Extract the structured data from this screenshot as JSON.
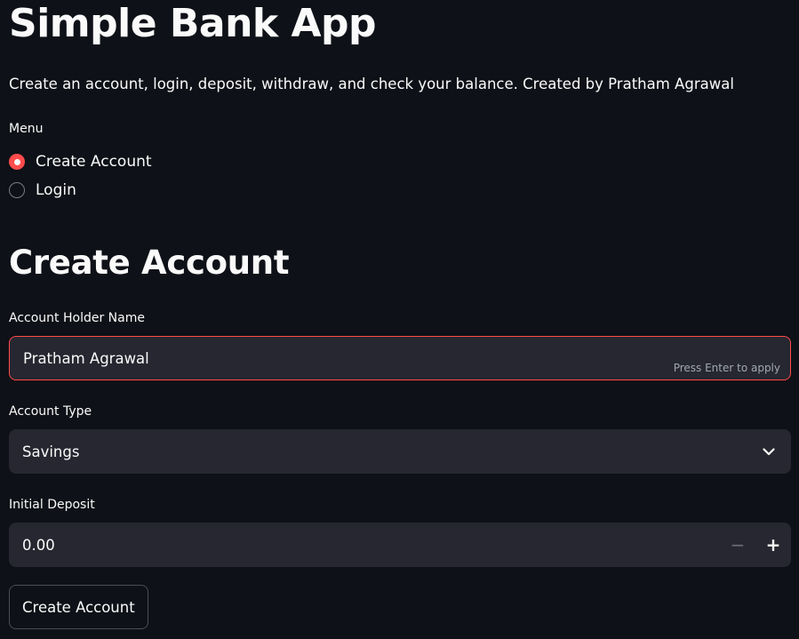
{
  "app": {
    "title": "Simple Bank App",
    "subtitle": "Create an account, login, deposit, withdraw, and check your balance. Created by Pratham Agrawal"
  },
  "menu": {
    "label": "Menu",
    "options": [
      {
        "label": "Create Account",
        "selected": true
      },
      {
        "label": "Login",
        "selected": false
      }
    ]
  },
  "form": {
    "heading": "Create Account",
    "name_field": {
      "label": "Account Holder Name",
      "value": "Pratham Agrawal",
      "hint": "Press Enter to apply"
    },
    "type_field": {
      "label": "Account Type",
      "value": "Savings",
      "icon": "chevron-down-icon"
    },
    "deposit_field": {
      "label": "Initial Deposit",
      "value": "0.00",
      "decrement": "−",
      "increment": "+"
    },
    "submit_label": "Create Account"
  },
  "colors": {
    "background": "#0e1117",
    "input_bg": "#262730",
    "accent": "#ff4b4b",
    "text": "#fafafa",
    "muted": "#a3a8b4"
  }
}
